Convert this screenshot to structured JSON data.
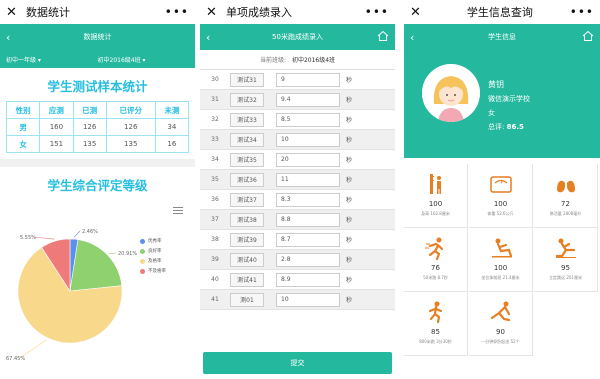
{
  "p1": {
    "window_title": "数据统计",
    "header_title": "数据统计",
    "grade": "初中一年级",
    "class": "初中2016级4班",
    "sample_title": "学生测试样本统计",
    "table_headers": [
      "性别",
      "应测",
      "已测",
      "已评分",
      "未测"
    ],
    "table_rows": [
      [
        "男",
        "160",
        "126",
        "126",
        "34"
      ],
      [
        "女",
        "151",
        "135",
        "135",
        "16"
      ]
    ],
    "grade_title": "学生综合评定等级"
  },
  "chart_data": {
    "type": "pie",
    "series": [
      {
        "name": "优秀率",
        "value": 2.46,
        "color": "#5b8ff0",
        "label": "2.46%"
      },
      {
        "name": "良好率",
        "value": 20.91,
        "color": "#8fd06f",
        "label": "20.91%"
      },
      {
        "name": "及格率",
        "value": 67.45,
        "color": "#f8d88b",
        "label": "67.45%"
      },
      {
        "name": "不及格率",
        "value": 9.18,
        "color": "#ef7a7a",
        "label": "5.55%"
      }
    ]
  },
  "p2": {
    "window_title": "单项成绩录入",
    "header_title": "50米跑成绩录入",
    "class_label": "当前班级:",
    "class_value": "初中2016级4班",
    "rows": [
      {
        "num": "30",
        "name": "测试31",
        "value": "9",
        "unit": "秒"
      },
      {
        "num": "31",
        "name": "测试32",
        "value": "9.4",
        "unit": "秒"
      },
      {
        "num": "32",
        "name": "测试33",
        "value": "8.5",
        "unit": "秒"
      },
      {
        "num": "33",
        "name": "测试34",
        "value": "10",
        "unit": "秒"
      },
      {
        "num": "34",
        "name": "测试35",
        "value": "20",
        "unit": "秒"
      },
      {
        "num": "35",
        "name": "测试36",
        "value": "11",
        "unit": "秒"
      },
      {
        "num": "36",
        "name": "测试37",
        "value": "8.3",
        "unit": "秒"
      },
      {
        "num": "37",
        "name": "测试38",
        "value": "8.8",
        "unit": "秒"
      },
      {
        "num": "38",
        "name": "测试39",
        "value": "8.7",
        "unit": "秒"
      },
      {
        "num": "39",
        "name": "测试40",
        "value": "2.8",
        "unit": "秒"
      },
      {
        "num": "40",
        "name": "测试41",
        "value": "8.9",
        "unit": "秒"
      },
      {
        "num": "41",
        "name": "测01",
        "value": "10",
        "unit": "秒"
      }
    ],
    "submit": "提交"
  },
  "p3": {
    "window_title": "学生信息查询",
    "header_title": "学生信息",
    "name": "黄钥",
    "school": "微信演示学校",
    "gender": "女",
    "score_label": "总评:",
    "score_value": "86.5",
    "items": [
      {
        "icon": "height-icon",
        "value": "100",
        "label": "身高 162.8厘米"
      },
      {
        "icon": "scale-icon",
        "value": "100",
        "label": "体重 52.6公斤"
      },
      {
        "icon": "lungs-icon",
        "value": "72",
        "label": "肺活量 2808毫升"
      },
      {
        "icon": "sprint-icon",
        "value": "76",
        "label": "50米跑 8.7秒"
      },
      {
        "icon": "situp-icon",
        "value": "100",
        "label": "坐位体前屈 21.4厘米"
      },
      {
        "icon": "jump-icon",
        "value": "95",
        "label": "立定跳远 201厘米"
      },
      {
        "icon": "run-icon",
        "value": "85",
        "label": "800米跑 3分30秒"
      },
      {
        "icon": "crunch-icon",
        "value": "90",
        "label": "一分钟仰卧起坐 52个"
      }
    ]
  }
}
